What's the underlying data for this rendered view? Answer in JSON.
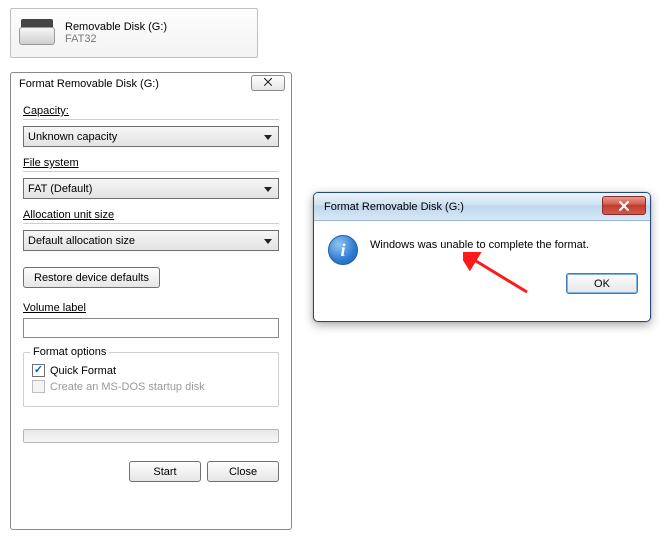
{
  "drive": {
    "title": "Removable Disk (G:)",
    "subtitle": "FAT32"
  },
  "format_dialog": {
    "title": "Format Removable Disk (G:)",
    "close_glyph": "⨉",
    "capacity_label": "Capacity:",
    "capacity_value": "Unknown capacity",
    "filesystem_label": "File system",
    "filesystem_value": "FAT (Default)",
    "alloc_label": "Allocation unit size",
    "alloc_value": "Default allocation size",
    "restore_label": "Restore device defaults",
    "volume_label": "Volume label",
    "volume_value": "",
    "options_legend": "Format options",
    "quick_format_label": "Quick Format",
    "msdos_label": "Create an MS-DOS startup disk",
    "start_label": "Start",
    "close_label": "Close"
  },
  "error_dialog": {
    "title": "Format Removable Disk (G:)",
    "message": "Windows was unable to complete the format.",
    "ok_label": "OK"
  }
}
